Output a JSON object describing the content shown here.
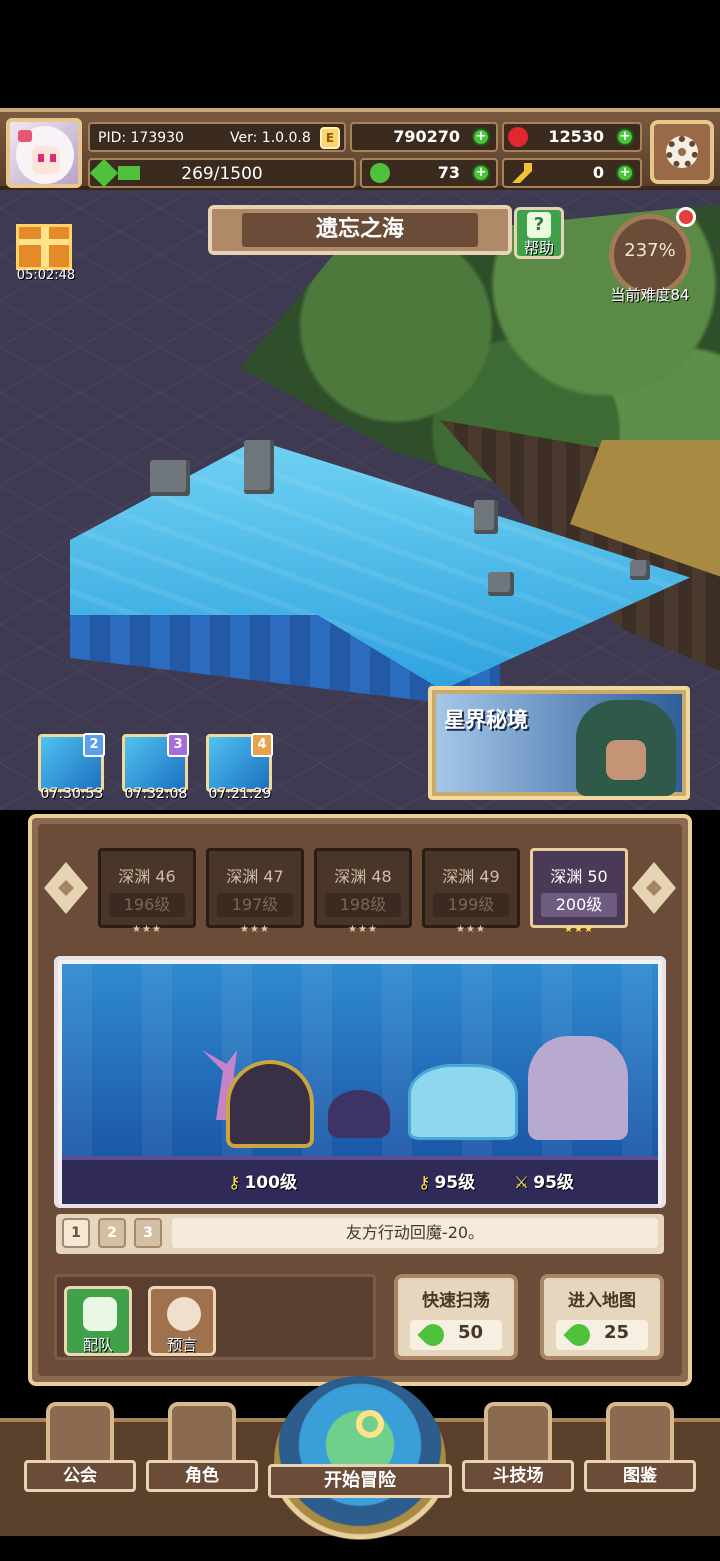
{
  "header": {
    "pid": "PID: 173930",
    "version": "Ver: 1.0.0.8",
    "coins": "790270",
    "gems": "12530",
    "exp": "269/1500",
    "clovers": "73",
    "keys": "0"
  },
  "map": {
    "location": "遗忘之海",
    "help_label": "帮助",
    "difficulty_percent": "237%",
    "difficulty_label": "当前难度84",
    "gift_timer": "05:02:48",
    "astral_title": "星界秘境",
    "chests": [
      {
        "num": "2",
        "timer": "07:30:53"
      },
      {
        "num": "3",
        "timer": "07:32:08"
      },
      {
        "num": "4",
        "timer": "07:21:29"
      }
    ]
  },
  "stages": [
    {
      "name": "深渊 46",
      "level": "196级",
      "stars": "★★★"
    },
    {
      "name": "深渊 47",
      "level": "197级",
      "stars": "★★★"
    },
    {
      "name": "深渊 48",
      "level": "198级",
      "stars": "★★★"
    },
    {
      "name": "深渊 49",
      "level": "199级",
      "stars": "★★★"
    },
    {
      "name": "深渊 50",
      "level": "200级",
      "stars": "★★★"
    }
  ],
  "battle": {
    "enemy_levels": [
      "100级",
      "95级",
      "95级"
    ],
    "tabs": [
      "1",
      "2",
      "3"
    ],
    "effect": "友方行动回魔-20。"
  },
  "actions": {
    "team_label": "配队",
    "forecast_label": "预言",
    "sweep_label": "快速扫荡",
    "sweep_cost": "50",
    "enter_label": "进入地图",
    "enter_cost": "25"
  },
  "nav": {
    "guild": "公会",
    "role": "角色",
    "adventure": "开始冒险",
    "arena": "斗技场",
    "codex": "图鉴"
  },
  "colors": {
    "accent_gold": "#e8cf9c",
    "panel_brown": "#6b4c39",
    "plus_green": "#4ec23c",
    "star_yellow": "#ffe04a"
  }
}
